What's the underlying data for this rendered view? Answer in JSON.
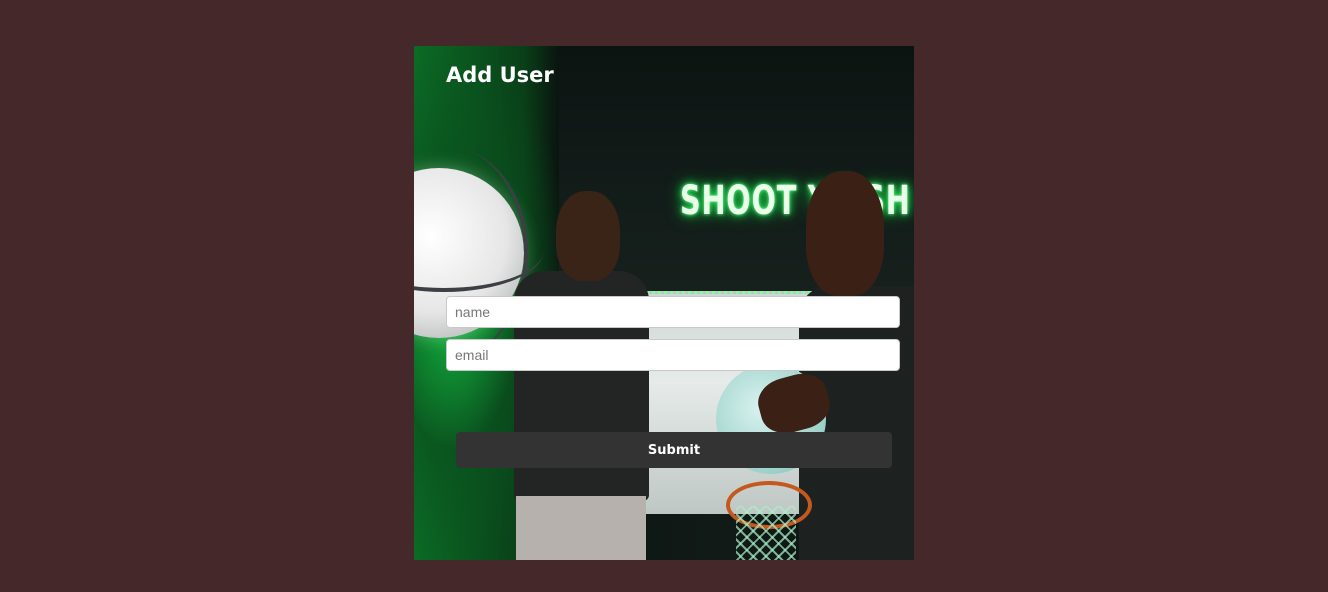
{
  "form": {
    "title": "Add User",
    "name_placeholder": "name",
    "email_placeholder": "email",
    "submit_label": "Submit"
  },
  "background_photo": {
    "neon_sign_text": "SHOOT YO SH"
  },
  "colors": {
    "page_background": "#45282a",
    "button_background": "#333333",
    "neon_green": "#21e354"
  }
}
